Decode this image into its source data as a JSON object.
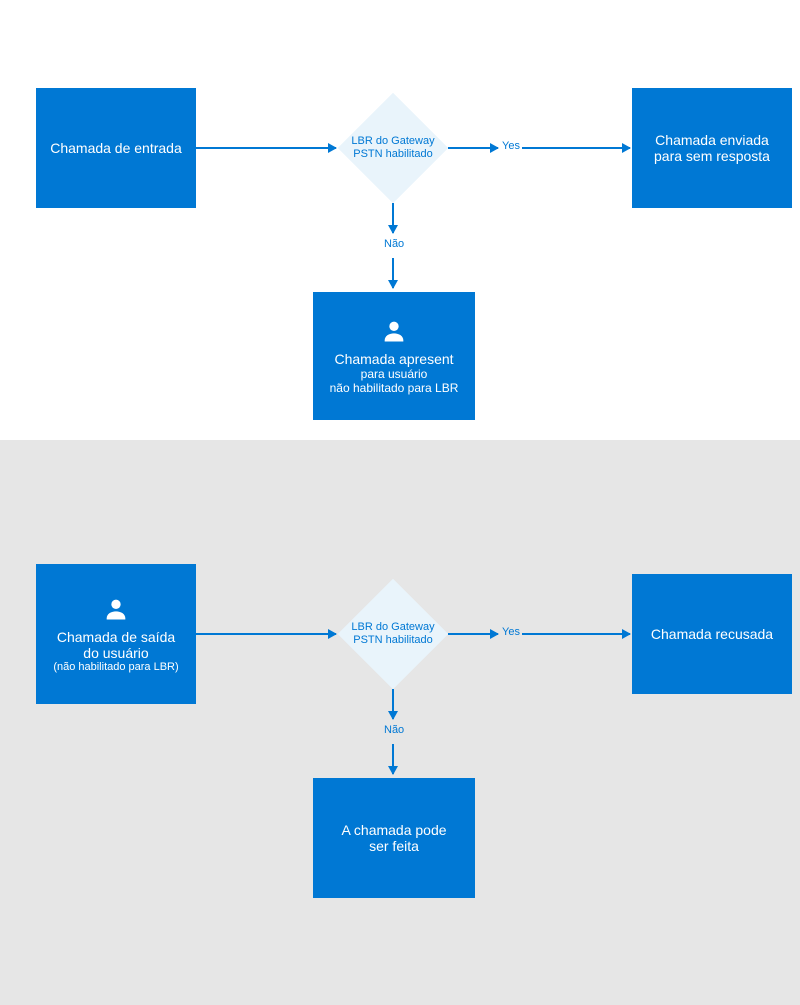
{
  "flow1": {
    "start": "Chamada de entrada",
    "decision_line1": "LBR do Gateway",
    "decision_line2": "PSTN habilitado",
    "yes_label": "Yes",
    "no_label": "Não",
    "yes_result_line1": "Chamada enviada",
    "yes_result_line2": "para sem resposta",
    "no_result_line1": "Chamada apresent",
    "no_result_line2": "para usuário",
    "no_result_line3": "não habilitado para LBR"
  },
  "flow2": {
    "start_line1": "Chamada de saída",
    "start_line2": "do usuário",
    "start_line3": "(não habilitado para LBR)",
    "decision_line1": "LBR do Gateway",
    "decision_line2": "PSTN habilitado",
    "yes_label": "Yes",
    "no_label": "Não",
    "yes_result": "Chamada recusada",
    "no_result_line1": "A chamada pode",
    "no_result_line2": "ser feita"
  }
}
